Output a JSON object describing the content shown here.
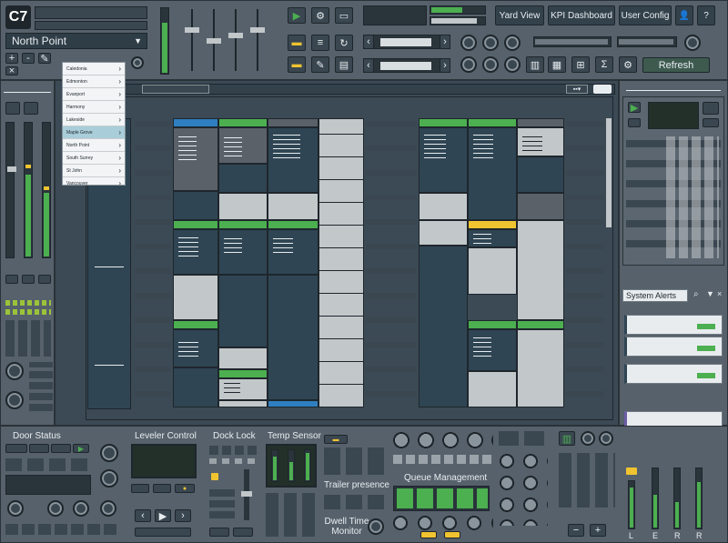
{
  "app": {
    "logo": "C7",
    "location": "North Point"
  },
  "location_menu": {
    "items": [
      "Caledonia",
      "Edmonton",
      "Evanport",
      "Harmony",
      "Lakeside",
      "Maple Grove",
      "North Point",
      "South Surrey",
      "St John",
      "Vancouver"
    ],
    "highlighted": "Maple Grove"
  },
  "header": {
    "yard_view": "Yard View",
    "kpi_dashboard": "KPI Dashboard",
    "user_config": "User Config",
    "help": "?",
    "refresh": "Refresh"
  },
  "alerts": {
    "title": "System Alerts"
  },
  "bottom": {
    "door_status": "Door Status",
    "leveler_control": "Leveler Control",
    "dock_lock": "Dock Lock",
    "temp_sensor": "Temp Sensor",
    "trailer_presence": "Trailer presence",
    "queue_management": "Queue Management",
    "dwell_time_monitor": "Dwell Time\nMonitor",
    "meter_labels": [
      "L",
      "E",
      "R",
      "R"
    ]
  },
  "icons": [
    "play-icon",
    "gear-icon",
    "battery-icon",
    "user-icon",
    "filter-icon",
    "search-icon",
    "sigma-icon",
    "chart-icon",
    "home-icon"
  ],
  "colors": {
    "accent_green": "#4caf50",
    "accent_yellow": "#f0c430",
    "accent_blue": "#2f7fc0",
    "grid_dark": "#2f4553",
    "grid_light": "#c2c7ca"
  }
}
